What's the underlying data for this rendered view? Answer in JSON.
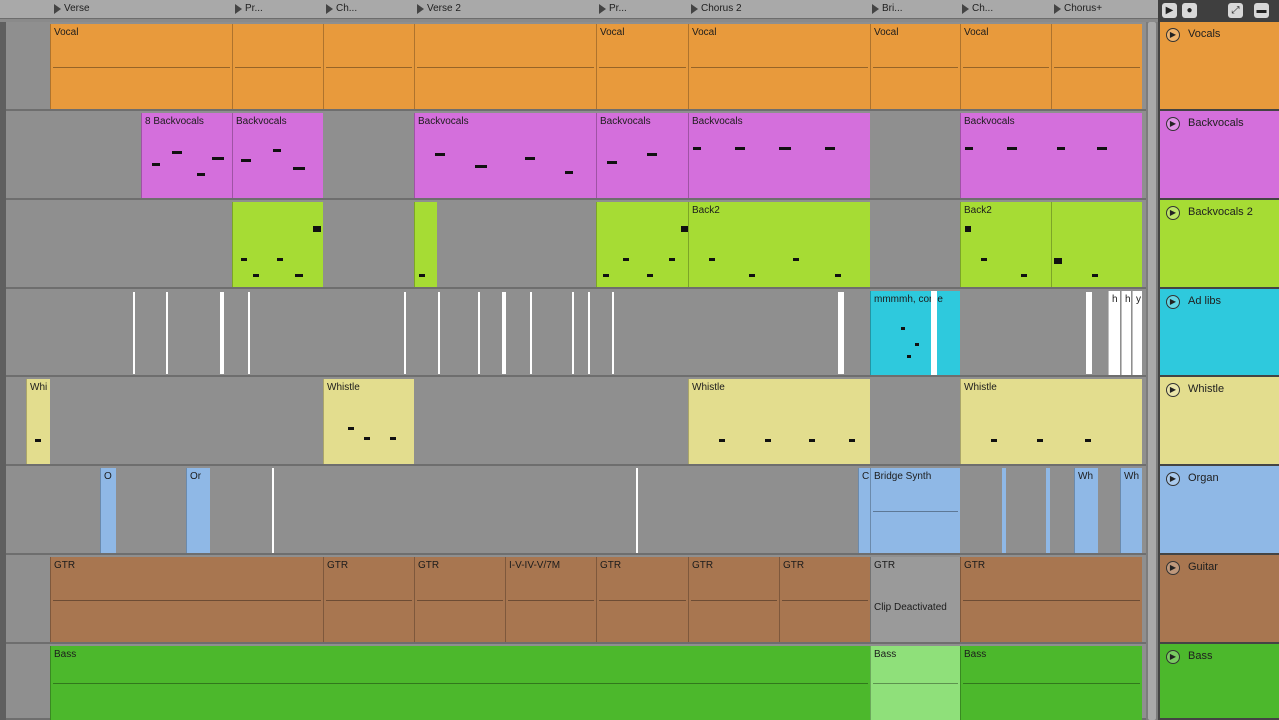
{
  "locators": [
    "Verse",
    "Pr...",
    "Ch...",
    "Verse 2",
    "Pr...",
    "Chorus 2",
    "Bri...",
    "Ch...",
    "Chorus+"
  ],
  "controls": [
    "▶",
    "●",
    "⤢",
    "▬"
  ],
  "colors": {
    "vocal": "#e89a3c",
    "backvocals": "#d46fdc",
    "backvocals2": "#a6dc34",
    "adlibs": "#2ec9dd",
    "whistle": "#e3dd8e",
    "organ": "#8fb8e6",
    "guitar": "#a87650",
    "bass": "#4cb82c",
    "empty_lane": "#8f8f8f"
  },
  "tracks": [
    {
      "name": "Vocals",
      "toggle": "▶",
      "color": "#e89a3c"
    },
    {
      "name": "Backvocals",
      "toggle": "▶",
      "color": "#d46fdc"
    },
    {
      "name": "Backvocals 2",
      "toggle": "▶",
      "color": "#a6dc34"
    },
    {
      "name": "Ad libs",
      "toggle": "▶",
      "color": "#2ec9dd"
    },
    {
      "name": "Whistle",
      "toggle": "▶",
      "color": "#e3dd8e"
    },
    {
      "name": "Organ",
      "toggle": "▶",
      "color": "#8fb8e6"
    },
    {
      "name": "Guitar",
      "toggle": "▶",
      "color": "#a87650"
    },
    {
      "name": "Bass",
      "toggle": "▶",
      "color": "#4cb82c"
    }
  ],
  "clips": {
    "vocals": [
      "Vocal",
      "",
      "",
      "",
      "Vocal",
      "Vocal",
      "Vocal",
      "Vocal",
      ""
    ],
    "backvocals": [
      "8 Backvocals",
      "Backvocals",
      "Backvocals",
      "Backvocals",
      "Backvocals",
      "Backvocals",
      ""
    ],
    "backvocals2": [
      "",
      "",
      "",
      "Back2",
      "Back2",
      ""
    ],
    "adlibs": [
      "mmmmh, come",
      "h",
      "h",
      "y"
    ],
    "whistle": [
      "Whi",
      "Whistle",
      "Whistle",
      "Whistle"
    ],
    "organ": [
      "O",
      "Or",
      "C",
      "Bridge Synth",
      "Wh",
      "Wh"
    ],
    "guitar": [
      "GTR",
      "GTR",
      "GTR",
      "I-V-IV-V/7M",
      "GTR",
      "GTR",
      "GTR",
      "GTR",
      "Clip Deactivated",
      "GTR"
    ],
    "bass": [
      "Bass",
      "Bass",
      "Bass"
    ]
  }
}
